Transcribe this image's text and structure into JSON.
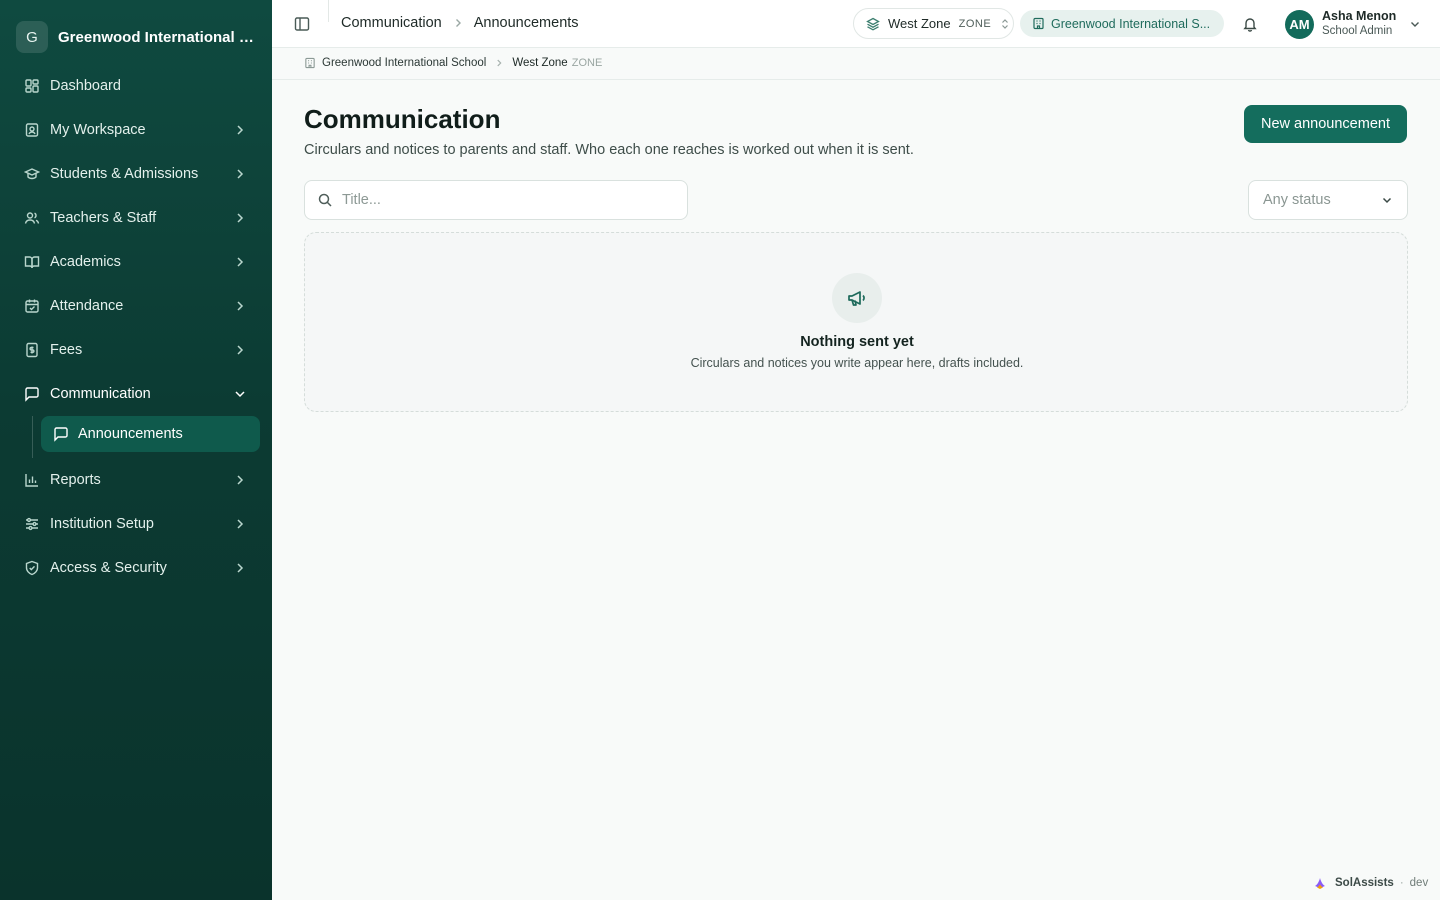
{
  "sidebar": {
    "brand_initial": "G",
    "brand_name": "Greenwood International Sc...",
    "items": [
      {
        "label": "Dashboard"
      },
      {
        "label": "My Workspace"
      },
      {
        "label": "Students & Admissions"
      },
      {
        "label": "Teachers & Staff"
      },
      {
        "label": "Academics"
      },
      {
        "label": "Attendance"
      },
      {
        "label": "Fees"
      },
      {
        "label": "Communication"
      },
      {
        "label": "Reports"
      },
      {
        "label": "Institution Setup"
      },
      {
        "label": "Access & Security"
      }
    ],
    "sub_items": [
      {
        "label": "Announcements"
      }
    ]
  },
  "topbar": {
    "breadcrumb": [
      "Communication",
      "Announcements"
    ],
    "zone_name": "West Zone",
    "zone_tag": "ZONE",
    "school_name": "Greenwood International S...",
    "user_initials": "AM",
    "user_name": "Asha Menon",
    "user_role": "School Admin"
  },
  "subcrumb": {
    "school": "Greenwood International School",
    "zone": "West Zone",
    "zone_tag": "ZONE"
  },
  "main": {
    "title": "Communication",
    "subtitle": "Circulars and notices to parents and staff. Who each one reaches is worked out when it is sent.",
    "new_button": "New announcement",
    "search_placeholder": "Title...",
    "status_value": "Any status",
    "empty_title": "Nothing sent yet",
    "empty_subtitle": "Circulars and notices you write appear here, drafts included."
  },
  "footer": {
    "name": "SolAssists",
    "separator": "·",
    "env": "dev"
  },
  "colors": {
    "sidebar_bg": "#0c3b33",
    "accent": "#146d5d",
    "active_item": "#0f5a4c"
  }
}
